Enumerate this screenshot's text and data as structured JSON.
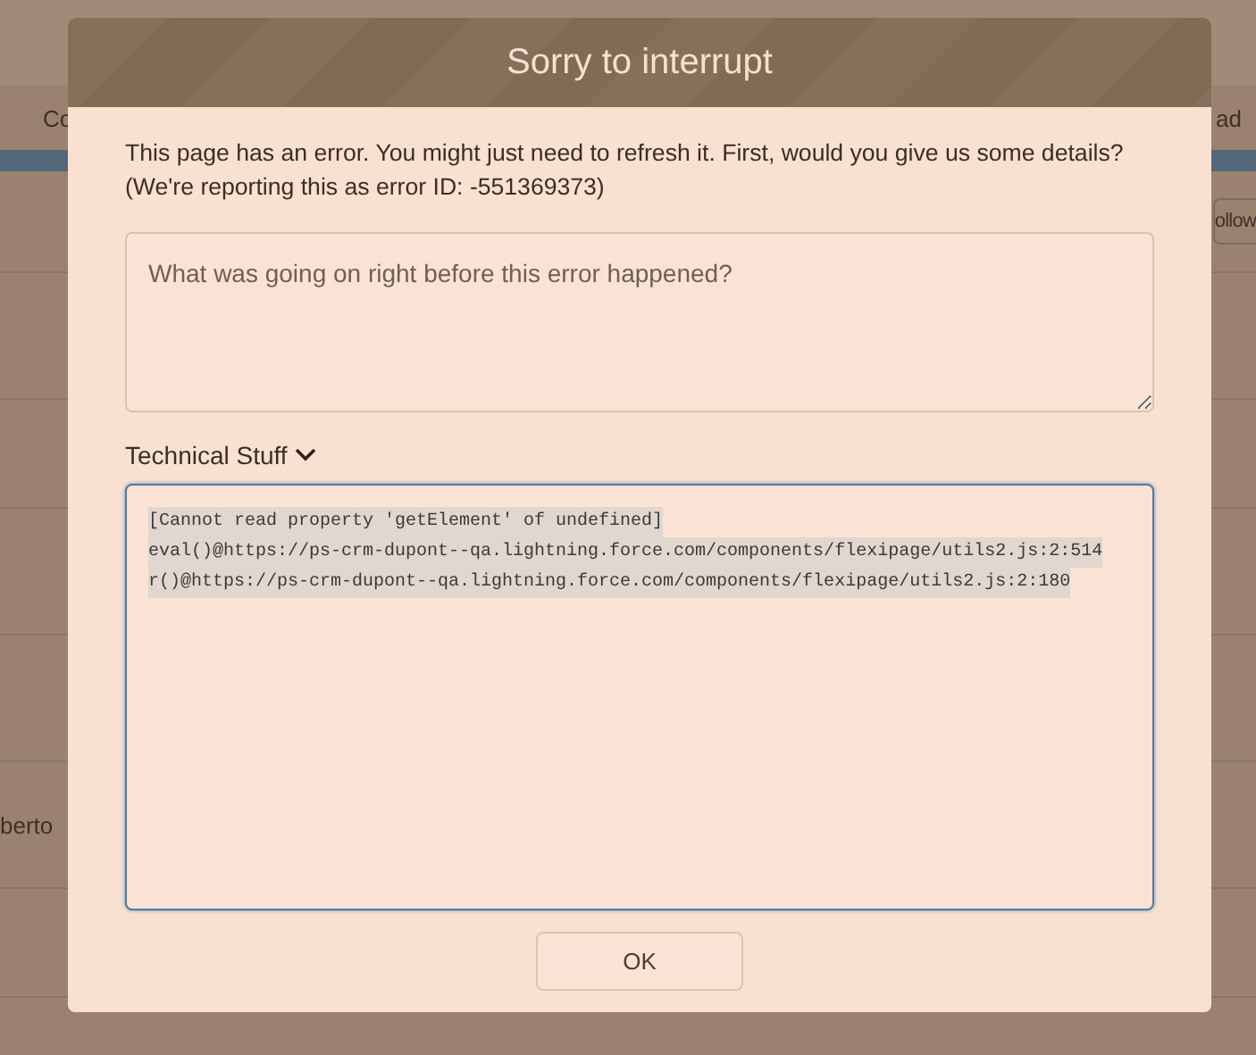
{
  "background": {
    "header_left": "Co",
    "header_right": "ad",
    "follow_button": "ollow",
    "row_name": "berto"
  },
  "dialog": {
    "title": "Sorry to interrupt",
    "message": [
      "This page has an error. You might just need to refresh it. First, would you give us some details?",
      "(We're reporting this as error ID: -551369373)"
    ],
    "feedback": {
      "placeholder": "What was going on right before this error happened?"
    },
    "technical": {
      "label": "Technical Stuff",
      "expanded": true,
      "lines": [
        "[Cannot read property 'getElement' of undefined]",
        "eval()@https://ps-crm-dupont--qa.lightning.force.com/components/flexipage/utils2.js:2:514",
        "r()@https://ps-crm-dupont--qa.lightning.force.com/components/flexipage/utils2.js:2:180"
      ]
    },
    "buttons": [
      "OK"
    ]
  }
}
